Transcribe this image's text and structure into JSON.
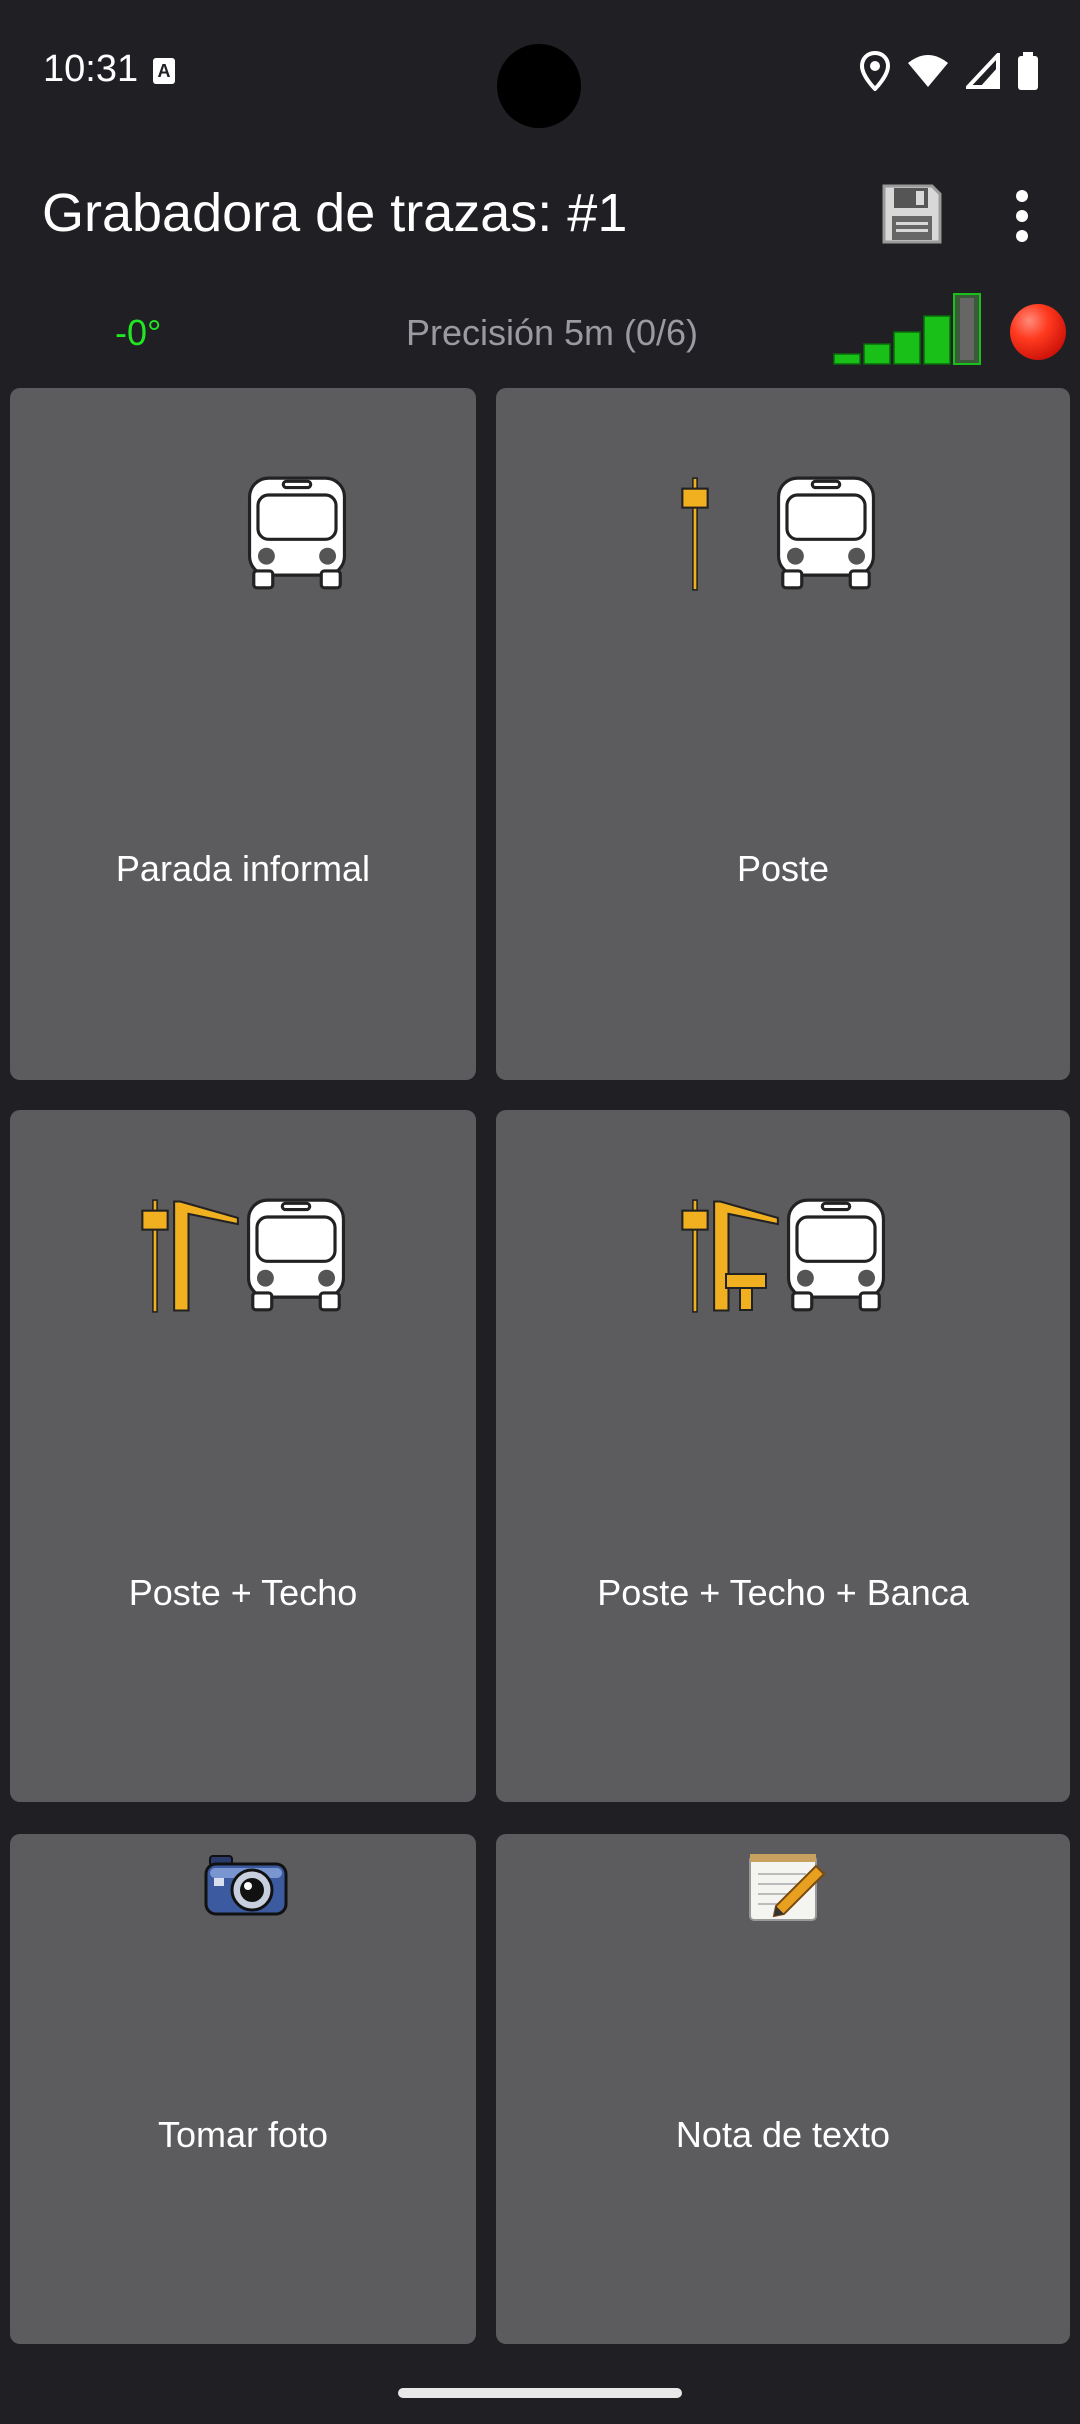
{
  "status_bar": {
    "time": "10:31",
    "notification_icon": "text-a-icon",
    "icons": [
      "location-icon",
      "wifi-icon",
      "cell-signal-icon",
      "battery-icon"
    ]
  },
  "app_bar": {
    "title": "Grabadora de trazas: #1",
    "actions": [
      "save-icon",
      "overflow-menu-icon"
    ]
  },
  "info_bar": {
    "heading": "-0°",
    "precision": "Precisión 5m (0/6)",
    "heading_color": "#22e622",
    "signal_bars_filled": 5,
    "signal_bars_total": 6,
    "recording_indicator_color": "#e01a0e"
  },
  "tiles": [
    {
      "label": "Parada informal",
      "icon": "bus-icon"
    },
    {
      "label": "Poste",
      "icon": "pole-bus-icon"
    },
    {
      "label": "Poste + Techo",
      "icon": "pole-roof-bus-icon"
    },
    {
      "label": "Poste + Techo + Banca",
      "icon": "pole-roof-bench-bus-icon"
    },
    {
      "label": "Tomar foto",
      "icon": "camera-icon"
    },
    {
      "label": "Nota de texto",
      "icon": "notepad-icon"
    }
  ],
  "colors": {
    "background": "#1f1f24",
    "tile": "#5c5c5e",
    "accent_yellow": "#f0b020"
  }
}
